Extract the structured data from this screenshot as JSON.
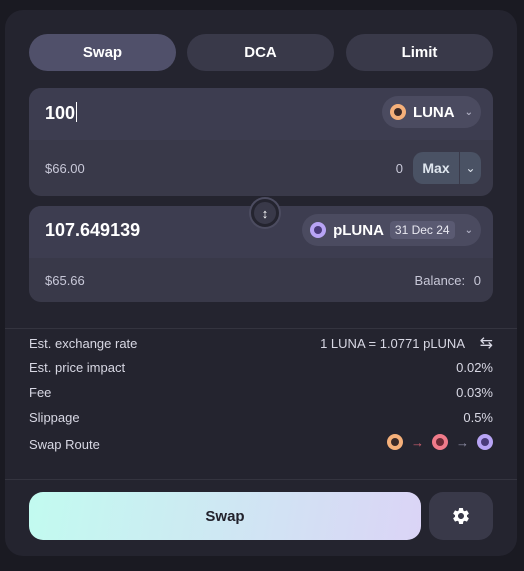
{
  "tabs": [
    {
      "label": "Swap",
      "active": true
    },
    {
      "label": "DCA",
      "active": false
    },
    {
      "label": "Limit",
      "active": false
    }
  ],
  "from": {
    "amount": "100",
    "token": "LUNA",
    "usd_value": "$66.00",
    "balance": "0",
    "max_label": "Max"
  },
  "to": {
    "amount": "107.649139",
    "token": "pLUNA",
    "maturity": "31 Dec 24",
    "usd_value": "$65.66",
    "balance_label": "Balance:",
    "balance": "0"
  },
  "details": {
    "exchange_rate_label": "Est. exchange rate",
    "exchange_rate_value": "1 LUNA = 1.0771 pLUNA",
    "price_impact_label": "Est. price impact",
    "price_impact_value": "0.02%",
    "fee_label": "Fee",
    "fee_value": "0.03%",
    "slippage_label": "Slippage",
    "slippage_value": "0.5%",
    "route_label": "Swap Route"
  },
  "actions": {
    "swap_label": "Swap"
  },
  "colors": {
    "background": "#1a1a22",
    "card": "#24242f",
    "panel": "#393949",
    "swap_gradient_start": "#c2fbf0",
    "swap_gradient_end": "#dbd4f6",
    "luna": "#f5b07a",
    "pluna": "#b8a4f5"
  }
}
